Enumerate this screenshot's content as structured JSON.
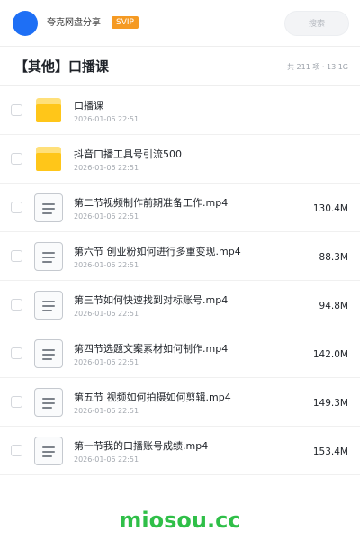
{
  "header": {
    "share_name": "夸克网盘分享",
    "badge": "SVIP",
    "search_placeholder": "搜索"
  },
  "folder": {
    "title": "【其他】口播课",
    "meta": "共 211 项 · 13.1G"
  },
  "items": [
    {
      "type": "folder",
      "icon": "folder-icon",
      "name": "口播课",
      "date": "2026-01-06 22:51",
      "size": ""
    },
    {
      "type": "folder",
      "icon": "folder-icon",
      "name": "抖音口播工具号引流500",
      "date": "2026-01-06 22:51",
      "size": ""
    },
    {
      "type": "file",
      "icon": "file-icon",
      "name": "第二节视频制作前期准备工作.mp4",
      "date": "2026-01-06 22:51",
      "size": "130.4M"
    },
    {
      "type": "file",
      "icon": "file-icon",
      "name": "第六节 创业粉如何进行多重变现.mp4",
      "date": "2026-01-06 22:51",
      "size": "88.3M"
    },
    {
      "type": "file",
      "icon": "file-icon",
      "name": "第三节如何快速找到对标账号.mp4",
      "date": "2026-01-06 22:51",
      "size": "94.8M"
    },
    {
      "type": "file",
      "icon": "file-icon",
      "name": "第四节选题文案素材如何制作.mp4",
      "date": "2026-01-06 22:51",
      "size": "142.0M"
    },
    {
      "type": "file",
      "icon": "file-icon",
      "name": "第五节 视频如何拍摄如何剪辑.mp4",
      "date": "2026-01-06 22:51",
      "size": "149.3M"
    },
    {
      "type": "file",
      "icon": "file-icon",
      "name": "第一节我的口播账号成绩.mp4",
      "date": "2026-01-06 22:51",
      "size": "153.4M"
    }
  ],
  "watermark": "miosou.cc",
  "colors": {
    "avatar": "#1e6ff5",
    "svip_badge": "#f59a23",
    "folder": "#ffc619",
    "watermark": "#2fbf48"
  }
}
